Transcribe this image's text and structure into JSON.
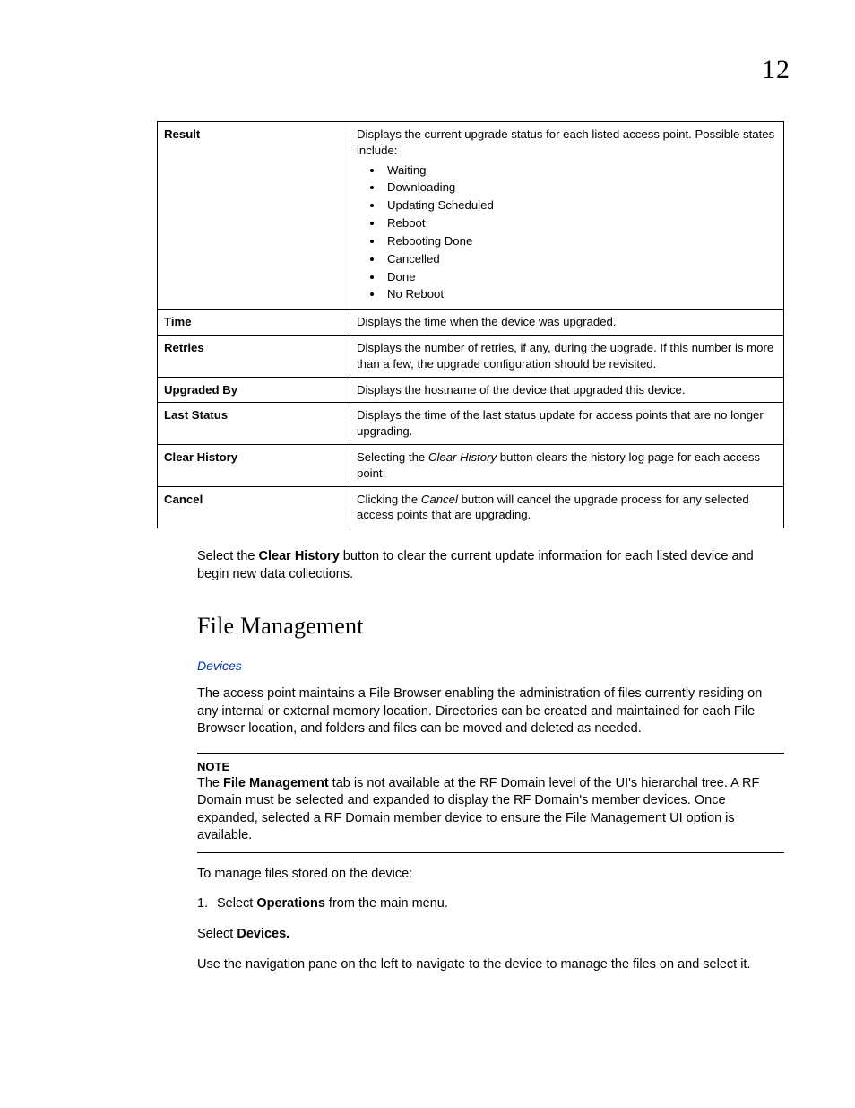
{
  "pageNumber": "12",
  "table": {
    "rows": [
      {
        "label": "Result",
        "desc_intro": "Displays the current upgrade status for each listed access point. Possible states include:",
        "states": [
          "Waiting",
          "Downloading",
          "Updating Scheduled",
          "Reboot",
          "Rebooting Done",
          "Cancelled",
          "Done",
          "No Reboot"
        ]
      },
      {
        "label": "Time",
        "desc": "Displays the time when the device was upgraded."
      },
      {
        "label": "Retries",
        "desc": "Displays the number of retries, if any, during the upgrade. If this number is more than a few, the upgrade configuration should be revisited."
      },
      {
        "label": "Upgraded By",
        "desc": "Displays the hostname of the device that upgraded this device."
      },
      {
        "label": "Last Status",
        "desc": "Displays the time of the last status update for access points that are no longer upgrading."
      },
      {
        "label": "Clear History",
        "desc_pre": "Selecting the ",
        "desc_em": "Clear History",
        "desc_post": " button clears the history log page for each access point."
      },
      {
        "label": "Cancel",
        "desc_pre": "Clicking the ",
        "desc_em": "Cancel",
        "desc_post": " button will cancel the upgrade process for any selected access points that are upgrading."
      }
    ]
  },
  "afterTable": {
    "pre": "Select the ",
    "bold": "Clear History",
    "post": " button to clear the current update information for each listed device and begin new data collections."
  },
  "heading": "File Management",
  "devicesLink": "Devices",
  "fmIntro": "The access point maintains a File Browser enabling the administration of files currently residing on any internal or external memory location. Directories can be created and maintained for each File Browser location, and folders and files can be moved and deleted as needed.",
  "note": {
    "label": "NOTE",
    "pre": "The ",
    "bold": "File Management",
    "post": " tab is not available at the RF Domain level of the UI's hierarchal tree. A RF Domain must be selected and expanded to display the RF Domain's member devices. Once expanded, selected a RF Domain member device to ensure the File Management UI option is available."
  },
  "manageIntro": "To manage files stored on the device:",
  "step1": {
    "num": "1.",
    "pre": "Select ",
    "bold": "Operations",
    "post": " from the main menu."
  },
  "selectDevices": {
    "pre": "Select ",
    "bold": "Devices."
  },
  "navPara": "Use the navigation pane on the left to navigate to the device to manage the files on and select it."
}
